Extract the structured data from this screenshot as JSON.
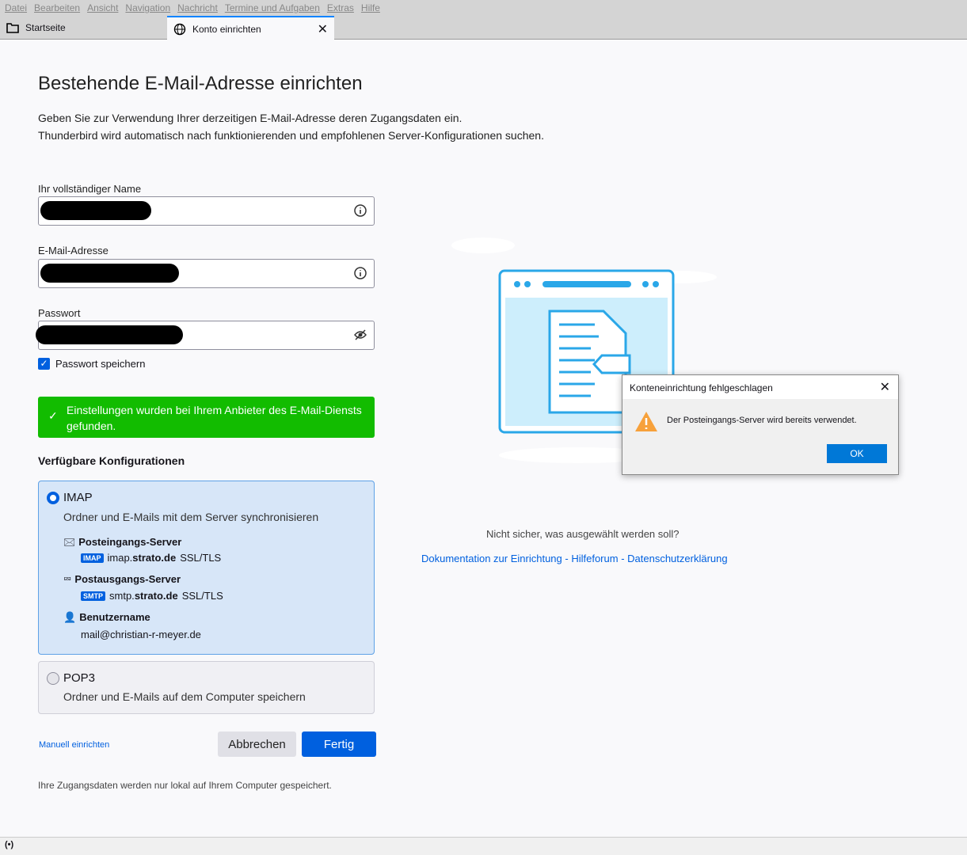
{
  "menu": [
    "Datei",
    "Bearbeiten",
    "Ansicht",
    "Navigation",
    "Nachricht",
    "Termine und Aufgaben",
    "Extras",
    "Hilfe"
  ],
  "tabs": {
    "home": "Startseite",
    "active": "Konto einrichten"
  },
  "title": "Bestehende E-Mail-Adresse einrichten",
  "intro": [
    "Geben Sie zur Verwendung Ihrer derzeitigen E-Mail-Adresse deren Zugangsdaten ein.",
    "Thunderbird wird automatisch nach funktionierenden und empfohlenen Server-Konfigurationen suchen."
  ],
  "fields": {
    "name_label": "Ihr vollständiger Name",
    "email_label": "E-Mail-Adresse",
    "password_label": "Passwort"
  },
  "remember_password": "Passwort speichern",
  "success": "Einstellungen wurden bei Ihrem Anbieter des E-Mail-Diensts gefunden.",
  "configs_heading": "Verfügbare Konfigurationen",
  "imap": {
    "title": "IMAP",
    "desc": "Ordner und E-Mails mit dem Server synchronisieren",
    "incoming_label": "Posteingangs-Server",
    "incoming_badge": "IMAP",
    "incoming_prefix": "imap.",
    "incoming_host": "strato.de",
    "incoming_sec": "SSL/TLS",
    "outgoing_label": "Postausgangs-Server",
    "outgoing_badge": "SMTP",
    "outgoing_prefix": "smtp.",
    "outgoing_host": "strato.de",
    "outgoing_sec": "SSL/TLS",
    "user_label": "Benutzername",
    "user": "mail@christian-r-meyer.de"
  },
  "pop3": {
    "title": "POP3",
    "desc": "Ordner und E-Mails auf dem Computer speichern"
  },
  "manual": "Manuell einrichten",
  "cancel": "Abbrechen",
  "done": "Fertig",
  "footer": "Ihre Zugangsdaten werden nur lokal auf Ihrem Computer gespeichert.",
  "help": "Nicht sicher, was ausgewählt werden soll?",
  "links": {
    "docs": "Dokumentation zur Einrichtung",
    "sep": " - ",
    "forum": "Hilfeforum",
    "privacy": "Datenschutzerklärung"
  },
  "dialog": {
    "title": "Konteneinrichtung fehlgeschlagen",
    "message": "Der Posteingangs-Server wird bereits verwendet.",
    "ok": "OK"
  },
  "status_icon": "(•)"
}
